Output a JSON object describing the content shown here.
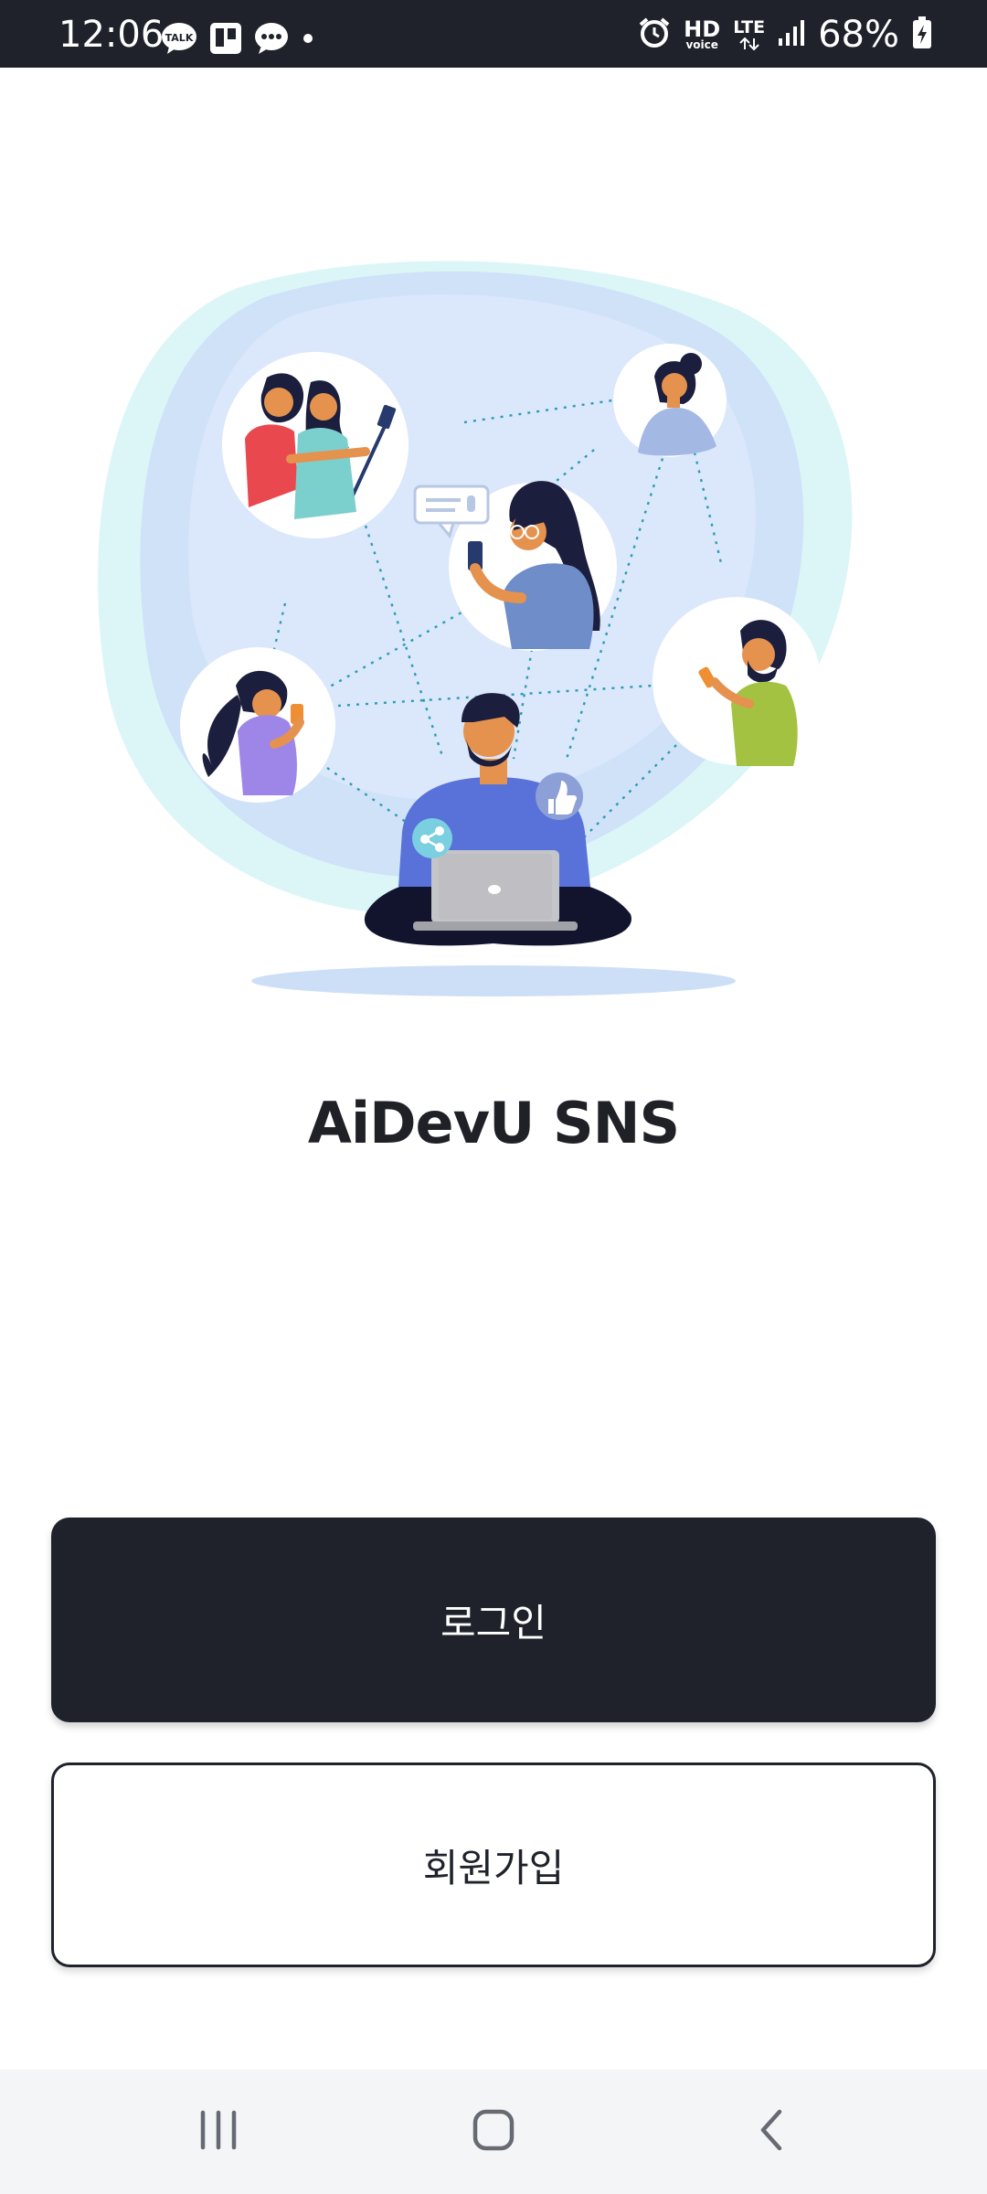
{
  "status_bar": {
    "time": "12:06",
    "notification_icons": [
      "kakaotalk-icon",
      "trello-icon",
      "chat-icon",
      "dot-icon"
    ],
    "hd_label": "HD",
    "voice_label": "voice",
    "lte_label": "LTE",
    "battery": "68%"
  },
  "hero": {
    "illustration": "people-connected-social-network"
  },
  "app": {
    "title": "AiDevU SNS"
  },
  "buttons": {
    "login": "로그인",
    "signup": "회원가입"
  },
  "nav_bar": {
    "items": [
      "recent-apps-icon",
      "home-icon",
      "back-icon"
    ]
  },
  "colors": {
    "dark": "#1f222b",
    "white": "#ffffff",
    "nav_bg": "#f4f5f7"
  }
}
